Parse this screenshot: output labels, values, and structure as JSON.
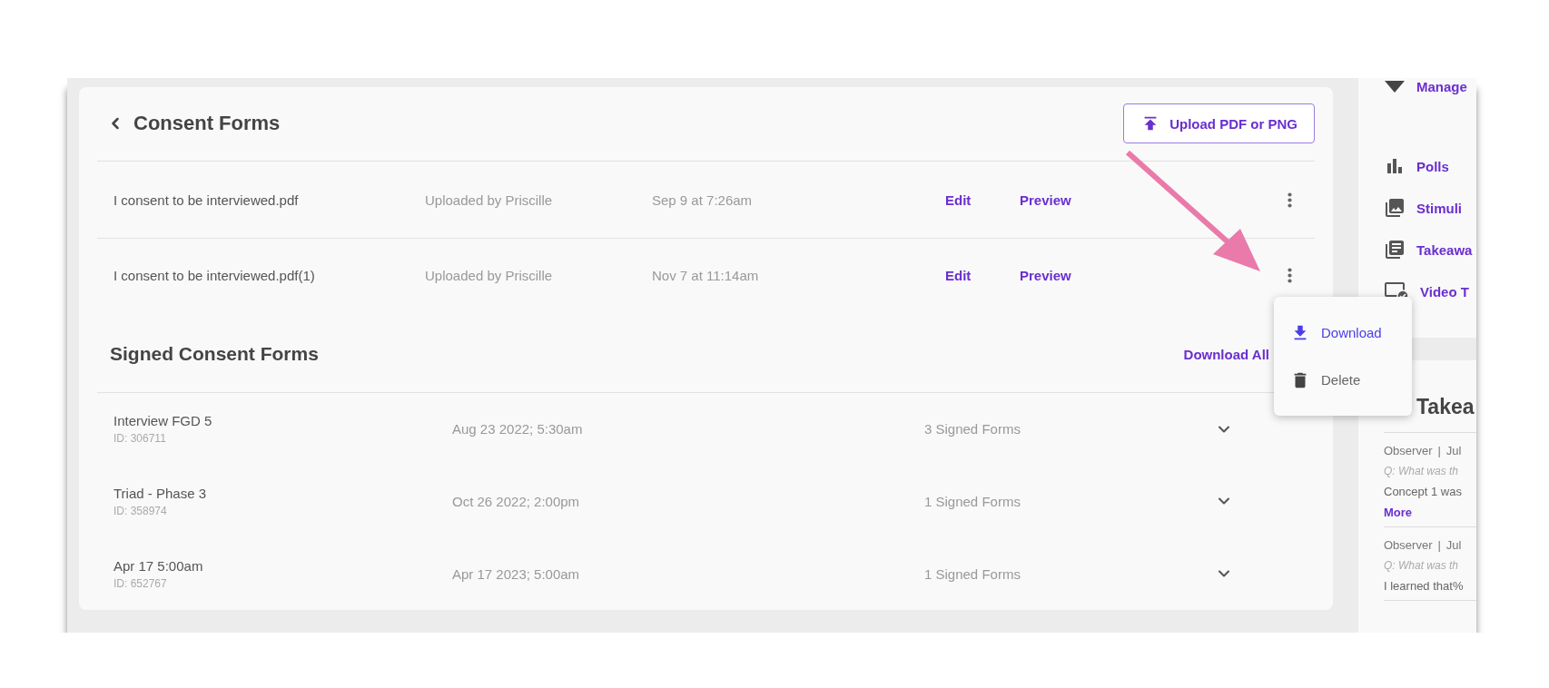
{
  "header": {
    "title": "Consent Forms",
    "upload_button": "Upload PDF or PNG"
  },
  "forms": [
    {
      "file": "I consent to be interviewed.pdf",
      "uploader": "Uploaded by Priscille",
      "date": "Sep 9 at 7:26am",
      "edit": "Edit",
      "preview": "Preview"
    },
    {
      "file": "I consent to be interviewed.pdf(1)",
      "uploader": "Uploaded by Priscille",
      "date": "Nov 7 at 11:14am",
      "edit": "Edit",
      "preview": "Preview"
    }
  ],
  "row_menu": {
    "items": [
      {
        "kind": "download",
        "label": "Download",
        "highlighted": true
      },
      {
        "kind": "delete",
        "label": "Delete",
        "highlighted": false
      }
    ]
  },
  "signed": {
    "title": "Signed Consent Forms",
    "download_all": "Download All",
    "rows": [
      {
        "name": "Interview FGD 5",
        "id": "ID: 306711",
        "date": "Aug 23 2022; 5:30am",
        "count": "3 Signed Forms"
      },
      {
        "name": "Triad - Phase 3",
        "id": "ID: 358974",
        "date": "Oct 26 2022; 2:00pm",
        "count": "1 Signed Forms"
      },
      {
        "name": "Apr 17 5:00am",
        "id": "ID: 652767",
        "date": "Apr 17 2023; 5:00am",
        "count": "1 Signed Forms"
      }
    ]
  },
  "sidebar": {
    "nav": [
      {
        "kind": "manage",
        "label": "Manage"
      },
      {
        "kind": "polls",
        "label": "Polls"
      },
      {
        "kind": "stimuli",
        "label": "Stimuli"
      },
      {
        "kind": "takeaways",
        "label": "Takeawa"
      },
      {
        "kind": "video",
        "label": "Video T"
      }
    ],
    "takeaways": {
      "title": "Takea",
      "items": [
        {
          "author": "Observer",
          "separator": "|",
          "date": "Jul",
          "question": "Q: What was th",
          "text": "Concept 1 was",
          "more": "More"
        },
        {
          "author": "Observer",
          "separator": "|",
          "date": "Jul",
          "question": "Q: What was th",
          "text": "I learned that%"
        }
      ]
    }
  }
}
